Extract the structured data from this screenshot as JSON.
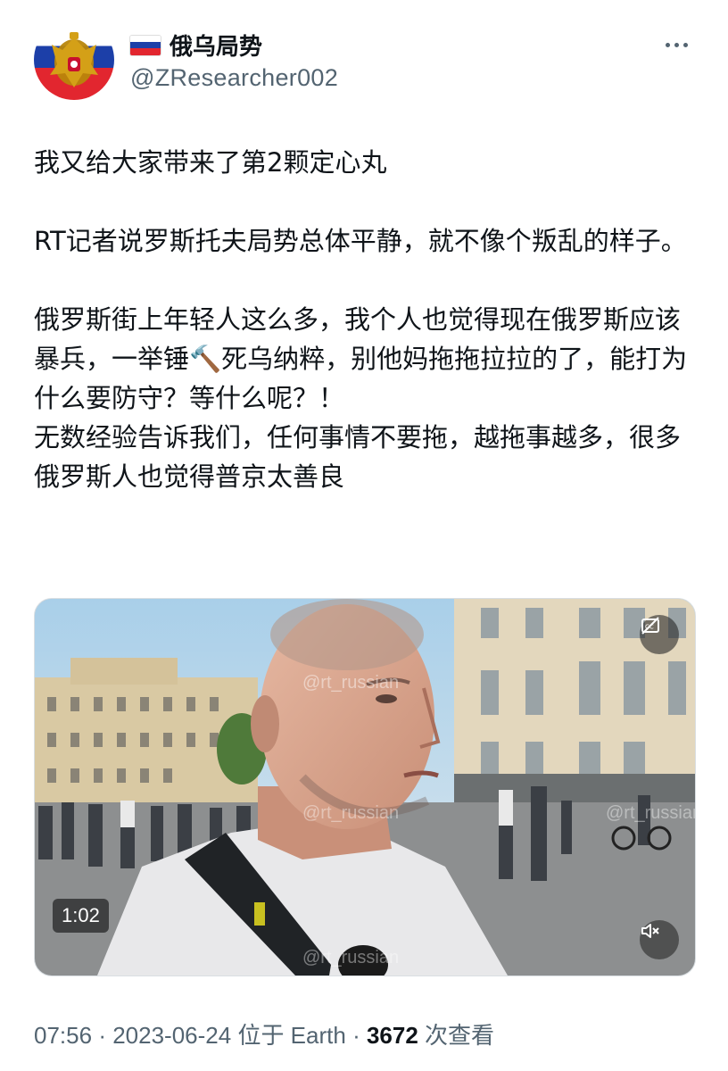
{
  "author": {
    "display_name": "俄乌局势",
    "handle": "@ZResearcher002",
    "flag": "russia-flag",
    "avatar": "russian-eagle-avatar"
  },
  "tweet": {
    "lines": [
      "我又给大家带来了第2颗定心丸",
      "RT记者说罗斯托夫局势总体平静，就不像个叛乱的样子。",
      "俄罗斯街上年轻人这么多，我个人也觉得现在俄罗斯应该暴兵，一举锤🔨死乌纳粹，别他妈拖拖拉拉的了，能打为什么要防守？等什么呢？！",
      "无数经验告诉我们，任何事情不要拖，越拖事越多，很多俄罗斯人也觉得普京太善良"
    ]
  },
  "video": {
    "duration": "1:02",
    "watermark": "@rt_russian",
    "cc_icon": "captions-off-icon",
    "mute_icon": "muted-speaker-icon"
  },
  "meta": {
    "time": "07:56",
    "date": "2023-06-24",
    "location": "位于 Earth",
    "views": "3672",
    "views_label": "次查看",
    "separator": "·"
  },
  "colors": {
    "text": "#0f1419",
    "secondary": "#536471",
    "flag_white": "#ffffff",
    "flag_blue": "#1c3fa8",
    "flag_red": "#e2262f"
  }
}
